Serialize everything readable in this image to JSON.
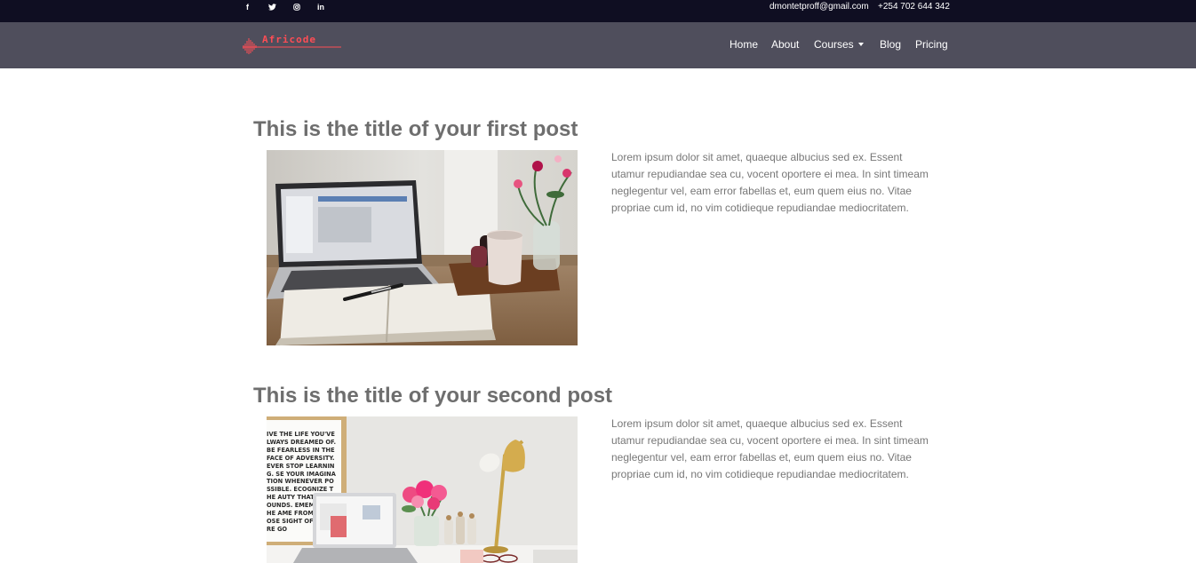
{
  "topbar": {
    "social": [
      {
        "icon": "facebook-icon",
        "glyph": "f"
      },
      {
        "icon": "twitter-icon"
      },
      {
        "icon": "instagram-icon"
      },
      {
        "icon": "linkedin-icon",
        "glyph": "in"
      }
    ],
    "email": "dmontetproff@gmail.com",
    "phone": "+254 702 644 342",
    "bg_color": "#0f0e22"
  },
  "navbar": {
    "logo_text": "Africode",
    "logo_color": "#ff4d55",
    "bg_color": "#4f4e5c",
    "links": [
      {
        "label": "Home"
      },
      {
        "label": "About"
      },
      {
        "label": "Courses"
      },
      {
        "label": "Blog"
      },
      {
        "label": "Pricing"
      }
    ]
  },
  "posts": [
    {
      "title": "This is the title of your first post",
      "excerpt": "Lorem ipsum dolor sit amet, quaeque albucius sed ex. Essent utamur repudiandae sea cu, vocent oportere ei mea. In sint timeam neglegentur vel, eam error fabellas et, eum quem eius no. Vitae propriae cum id, no vim cotidieque repudiandae mediocritatem."
    },
    {
      "title": "This is the title of your second post",
      "excerpt": "Lorem ipsum dolor sit amet, quaeque albucius sed ex. Essent utamur repudiandae sea cu, vocent oportere ei mea. In sint timeam neglegentur vel, eam error fabellas et, eum quem eius no. Vitae propriae cum id, no vim cotidieque repudiandae mediocritatem.",
      "poster_text": "IVE THE LIFE YOU'VE LWAYS DREAMED OF. BE FEARLESS IN THE FACE OF ADVERSITY. EVER STOP LEARNING. SE YOUR IMAGINATION WHENEVER POSSIBLE. ECOGNIZE THE AUTY THAT SURROUNDS. EMEMBER WHE AME FROM, BUT LOSE SIGHT OF YOU ARE GO"
    }
  ]
}
